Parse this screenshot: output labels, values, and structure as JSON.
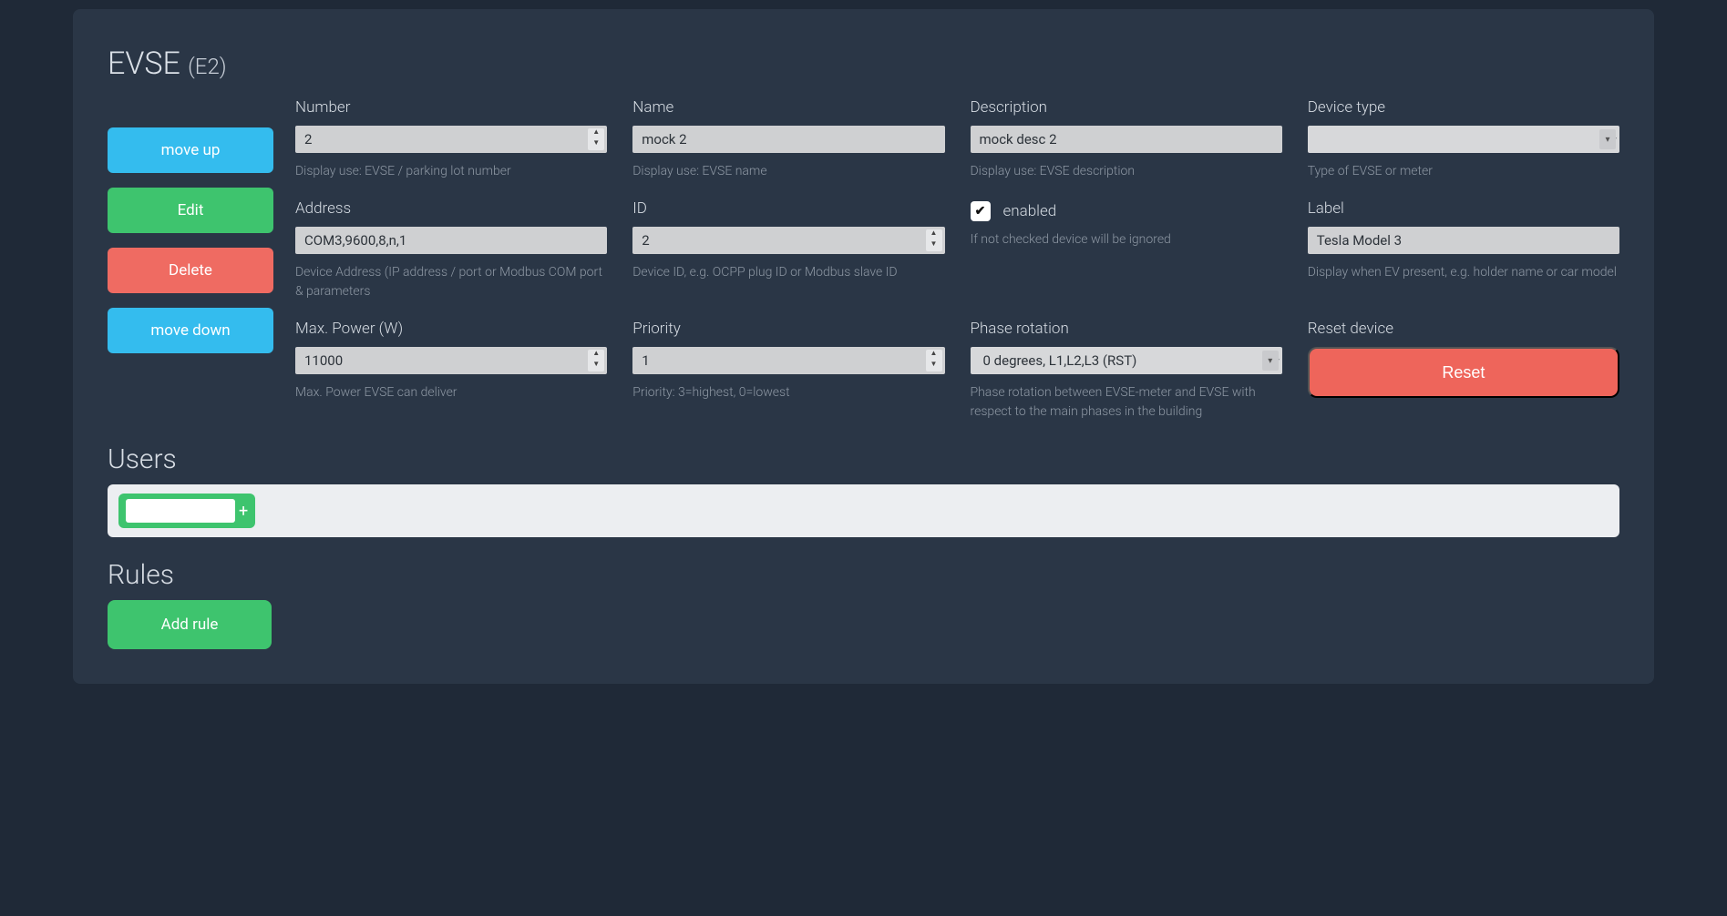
{
  "header": {
    "title": "EVSE",
    "subtitle": "(E2)"
  },
  "actions": {
    "move_up": "move up",
    "edit": "Edit",
    "delete": "Delete",
    "move_down": "move down"
  },
  "fields": {
    "number": {
      "label": "Number",
      "value": "2",
      "help": "Display use: EVSE / parking lot number"
    },
    "name": {
      "label": "Name",
      "value": "mock 2",
      "help": "Display use: EVSE name"
    },
    "description": {
      "label": "Description",
      "value": "mock desc 2",
      "help": "Display use: EVSE description"
    },
    "device_type": {
      "label": "Device type",
      "value": "",
      "help": "Type of EVSE or meter"
    },
    "address": {
      "label": "Address",
      "value": "COM3,9600,8,n,1",
      "help": "Device Address (IP address / port or Modbus COM port & parameters"
    },
    "id": {
      "label": "ID",
      "value": "2",
      "help": "Device ID, e.g. OCPP plug ID or Modbus slave ID"
    },
    "enabled": {
      "label": "enabled",
      "checked": true,
      "help": "If not checked device will be ignored"
    },
    "label_field": {
      "label": "Label",
      "value": "Tesla Model 3",
      "help": "Display when EV present, e.g. holder name or car model"
    },
    "max_power": {
      "label": "Max. Power (W)",
      "value": "11000",
      "help": "Max. Power EVSE can deliver"
    },
    "priority": {
      "label": "Priority",
      "value": "1",
      "help": "Priority: 3=highest, 0=lowest"
    },
    "phase_rotation": {
      "label": "Phase rotation",
      "value": "0 degrees, L1,L2,L3 (RST)",
      "help": "Phase rotation between EVSE-meter and EVSE with respect to the main phases in the building"
    },
    "reset": {
      "label": "Reset device",
      "button": "Reset"
    }
  },
  "users": {
    "heading": "Users",
    "input_value": "",
    "plus": "+"
  },
  "rules": {
    "heading": "Rules",
    "add_button": "Add rule"
  }
}
